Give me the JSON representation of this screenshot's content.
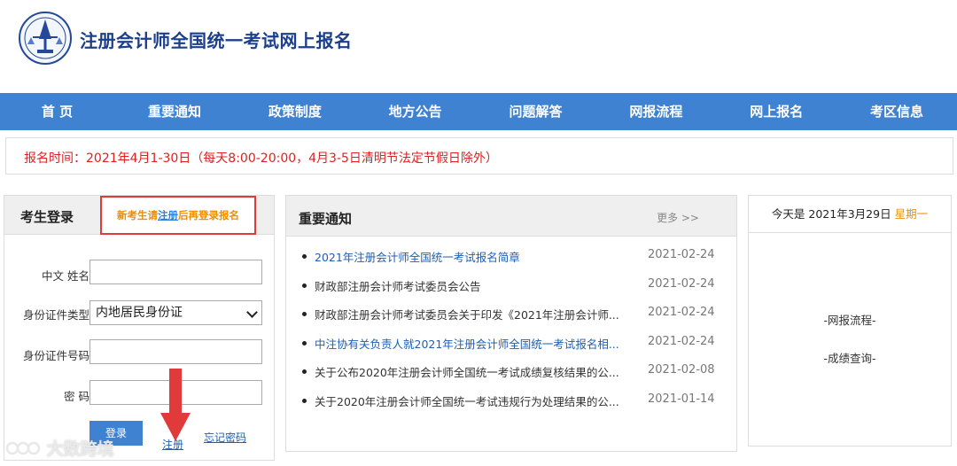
{
  "header": {
    "title": "注册会计师全国统一考试网上报名"
  },
  "nav": {
    "items": [
      "首 页",
      "重要通知",
      "政策制度",
      "地方公告",
      "问题解答",
      "网报流程",
      "网上报名",
      "考区信息"
    ]
  },
  "notice": {
    "text": "报名时间：2021年4月1-30日（每天8:00-20:00，4月3-5日清明节法定节假日除外）"
  },
  "login": {
    "title": "考生登录",
    "hint_prefix": "新考生请",
    "hint_link": "注册",
    "hint_suffix": "后再登录报名",
    "name_label": "中文  姓名",
    "name_value": "",
    "idtype_label": "身份证件类型",
    "idtype_value": "内地居民身份证",
    "idnum_label": "身份证件号码",
    "idnum_value": "",
    "password_label": "密       码",
    "password_value": "",
    "login_button": "登录",
    "register_link": "注册",
    "forgot_link": "忘记密码"
  },
  "news": {
    "title": "重要通知",
    "more": "更多 >>",
    "items": [
      {
        "title": "2021年注册会计师全国统一考试报名简章",
        "date": "2021-02-24",
        "highlight": true
      },
      {
        "title": "财政部注册会计师考试委员会公告",
        "date": "2021-02-24",
        "highlight": false
      },
      {
        "title": "财政部注册会计师考试委员会关于印发《2021年注册会计师...",
        "date": "2021-02-24",
        "highlight": false
      },
      {
        "title": "中注协有关负责人就2021年注册会计师全国统一考试报名相...",
        "date": "2021-02-24",
        "highlight": true
      },
      {
        "title": "关于公布2020年注册会计师全国统一考试成绩复核结果的公...",
        "date": "2021-02-08",
        "highlight": false
      },
      {
        "title": "关于2020年注册会计师全国统一考试违规行为处理结果的公...",
        "date": "2021-01-14",
        "highlight": false
      }
    ]
  },
  "side": {
    "date_prefix": "今天是 2021年3月29日",
    "weekday": "星期一",
    "link1": "-网报流程-",
    "link2": "-成绩查询-"
  },
  "watermark": {
    "text": "大数跨境"
  },
  "colors": {
    "nav_bg": "#3f82d2",
    "title_blue": "#1c3f8c",
    "notice_red": "#e02020",
    "hint_orange": "#f08c00",
    "arrow_red": "#e03a3a"
  }
}
